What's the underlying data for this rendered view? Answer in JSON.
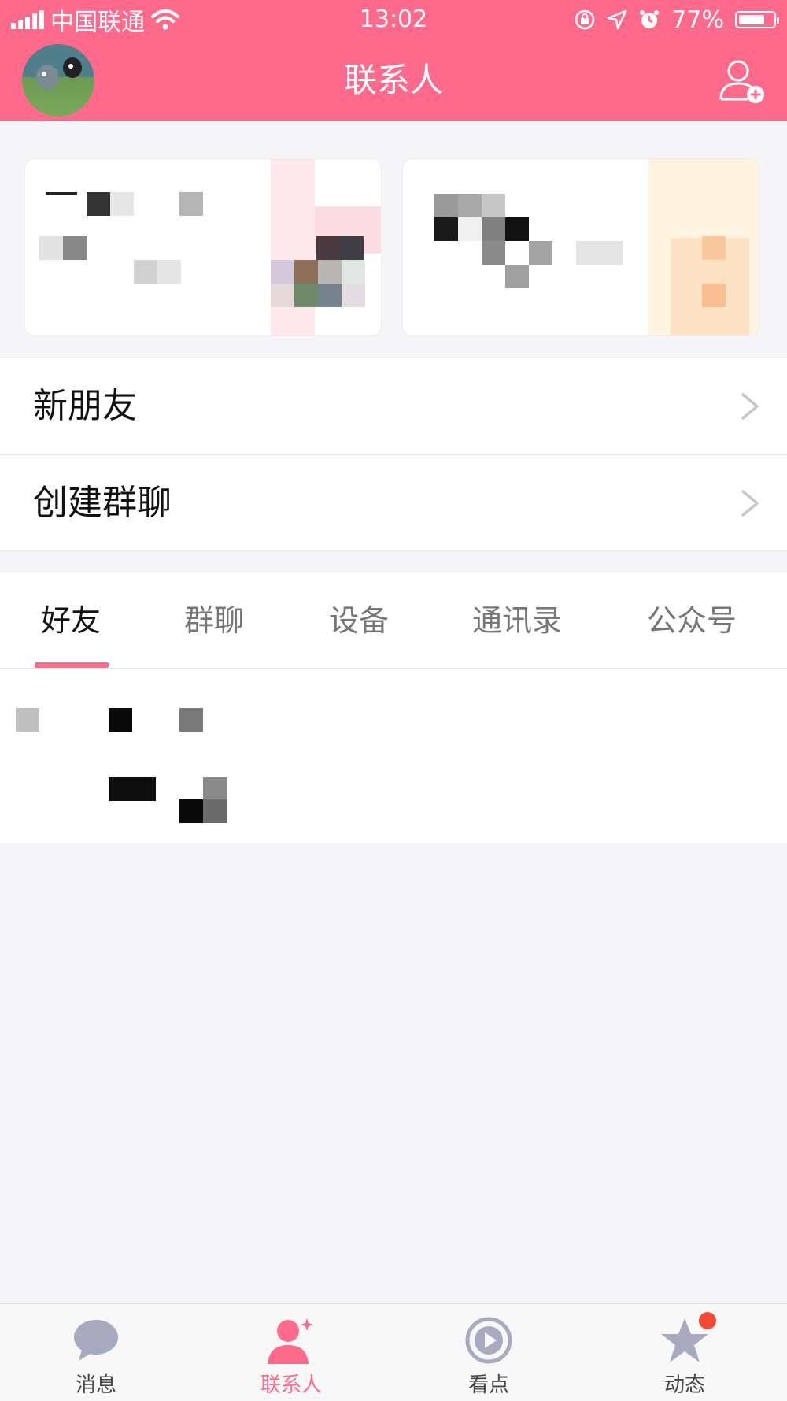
{
  "status_bar": {
    "carrier": "中国联通",
    "time": "13:02",
    "battery_percent_text": "77%",
    "battery_level": 0.77
  },
  "header": {
    "title": "联系人",
    "icons": {
      "avatar": "avatar-image",
      "add": "add-contact-icon"
    }
  },
  "menu": {
    "new_friends": "新朋友",
    "create_group": "创建群聊"
  },
  "tabs": [
    "好友",
    "群聊",
    "设备",
    "通讯录",
    "公众号"
  ],
  "active_tab": "好友",
  "bottom_nav": {
    "items": [
      "消息",
      "联系人",
      "看点",
      "动态"
    ],
    "active": "联系人"
  },
  "colors": {
    "brand": "#fe6a8c",
    "badge": "#f24a34"
  }
}
